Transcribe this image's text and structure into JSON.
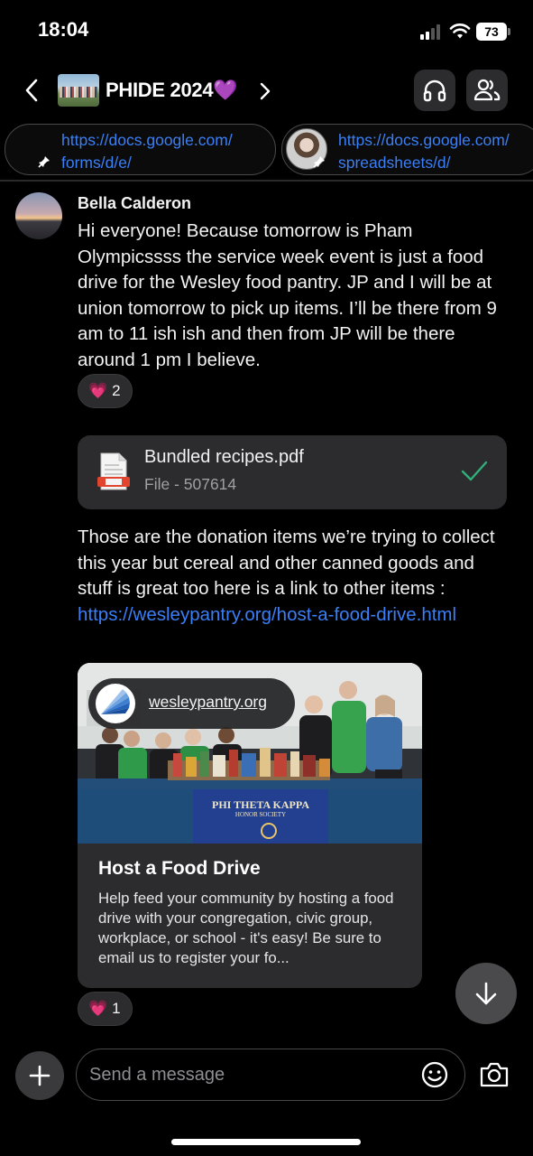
{
  "status_bar": {
    "time": "18:04",
    "battery": "73"
  },
  "header": {
    "title": "PHIDE 2024💜",
    "icons": [
      "back-icon",
      "chevron-right-icon",
      "headphones-icon",
      "members-icon"
    ]
  },
  "pinned_links": [
    {
      "line1": "https://docs.google.com/",
      "line2": "forms/d/e/"
    },
    {
      "line1": "https://docs.google.com/",
      "line2": "spreadsheets/d/"
    }
  ],
  "message": {
    "sender": "Bella Calderon",
    "text1": "Hi everyone! Because tomorrow is Pham Olympicssss the service week event is just a food drive for the Wesley food pantry. JP and I will be at union tomorrow to pick up items. I’ll be there from 9 am to 11 ish ish  and then from JP will be there around 1 pm I believe.",
    "reaction1": {
      "emoji": "💗",
      "count": "2"
    },
    "file": {
      "name": "Bundled recipes.pdf",
      "meta": "File - 507614"
    },
    "text2": "Those are the donation items we’re trying to collect this year but cereal and other canned goods and stuff is great too here is a link to other items : ",
    "link": "https://wesleypantry.org/host-a-food-drive.html",
    "preview": {
      "site": "wesleypantry.org",
      "banner_line1": "PHI THETA KAPPA",
      "banner_line2": "HONOR SOCIETY",
      "title": "Host a Food Drive",
      "description": "Help feed your community by hosting a food drive with your congregation, civic group, workplace, or school - it's easy! Be sure to email us to register your fo..."
    },
    "reaction2": {
      "emoji": "💗",
      "count": "1"
    }
  },
  "composer": {
    "placeholder": "Send a message"
  },
  "colors": {
    "link": "#3b7ff6",
    "check": "#30b07a",
    "surface": "#2c2c2e"
  }
}
